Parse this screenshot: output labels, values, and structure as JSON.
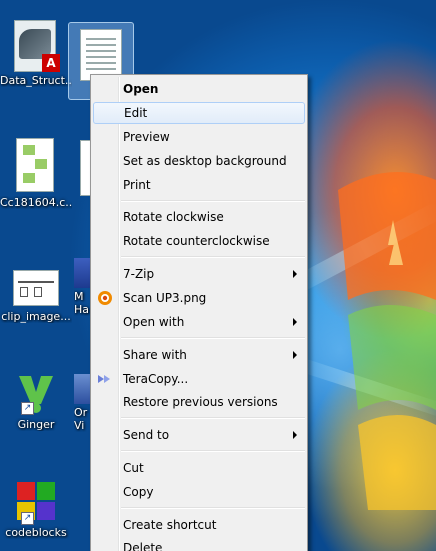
{
  "desktop": {
    "icons": [
      {
        "caption": "Data_Struct..."
      },
      {
        "caption": "Cc181604.c..."
      },
      {
        "caption": "clip_image..."
      },
      {
        "caption": "Ginger"
      },
      {
        "caption": "codeblocks"
      },
      {
        "caption": "M"
      },
      {
        "caption": "Ha"
      },
      {
        "caption": "Or"
      },
      {
        "caption": "Vi"
      }
    ]
  },
  "context_menu": {
    "items": [
      {
        "label": "Open",
        "bold": true
      },
      {
        "label": "Edit",
        "hover": true
      },
      {
        "label": "Preview"
      },
      {
        "label": "Set as desktop background"
      },
      {
        "label": "Print"
      },
      {
        "label": "Rotate clockwise"
      },
      {
        "label": "Rotate counterclockwise"
      },
      {
        "label": "7-Zip",
        "submenu": true
      },
      {
        "label": "Scan UP3.png",
        "icon": "antivirus-scan-icon"
      },
      {
        "label": "Open with",
        "submenu": true
      },
      {
        "label": "Share with",
        "submenu": true
      },
      {
        "label": "TeraCopy...",
        "icon": "teracopy-icon"
      },
      {
        "label": "Restore previous versions"
      },
      {
        "label": "Send to",
        "submenu": true
      },
      {
        "label": "Cut"
      },
      {
        "label": "Copy"
      },
      {
        "label": "Create shortcut"
      },
      {
        "label": "Delete"
      }
    ]
  },
  "colors": {
    "menu_background": "#f0f0f0",
    "menu_border": "#979797",
    "hover_border": "#aecff7",
    "desktop_blue": "#1579cf"
  }
}
